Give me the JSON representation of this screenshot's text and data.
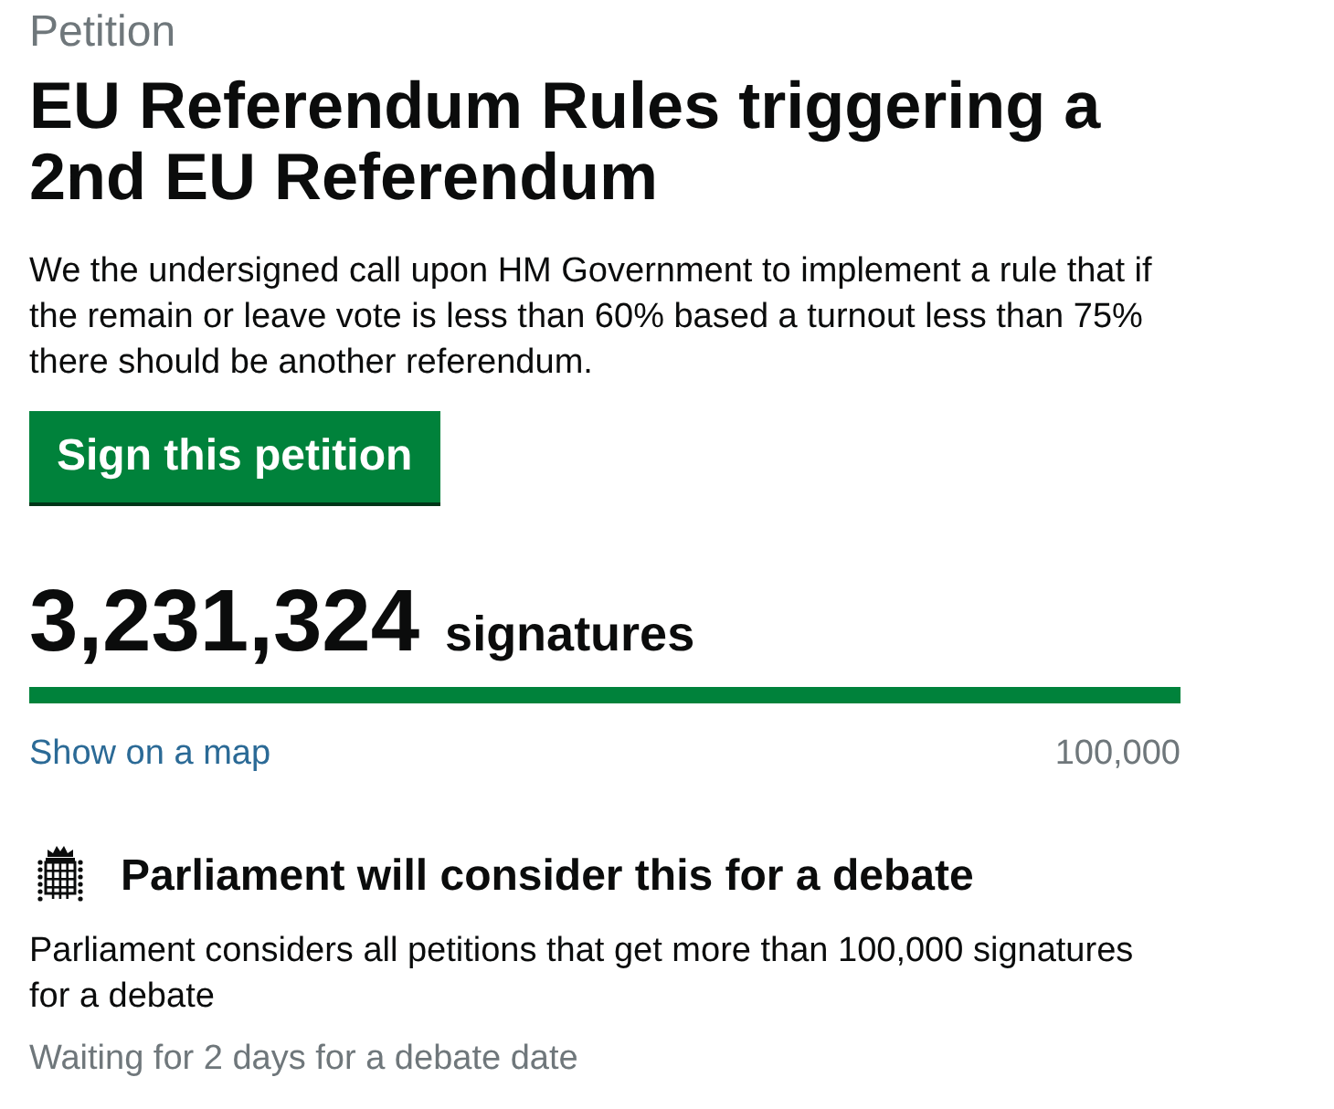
{
  "header": {
    "label": "Petition",
    "title": "EU Referendum Rules triggering a 2nd EU Referendum"
  },
  "description": "We the undersigned call upon HM Government to implement a rule that if the remain or leave vote is less than 60% based a turnout less than 75% there should be another referendum.",
  "sign_button": "Sign this petition",
  "signatures": {
    "count": "3,231,324",
    "label": "signatures",
    "progress": {
      "level": 1
    },
    "map_link": "Show on a map",
    "threshold": "100,000"
  },
  "debate": {
    "heading": "Parliament will consider this for a debate",
    "text": "Parliament considers all petitions that get more than 100,000 signatures for a debate",
    "status": "Waiting for 2 days for a debate date"
  }
}
